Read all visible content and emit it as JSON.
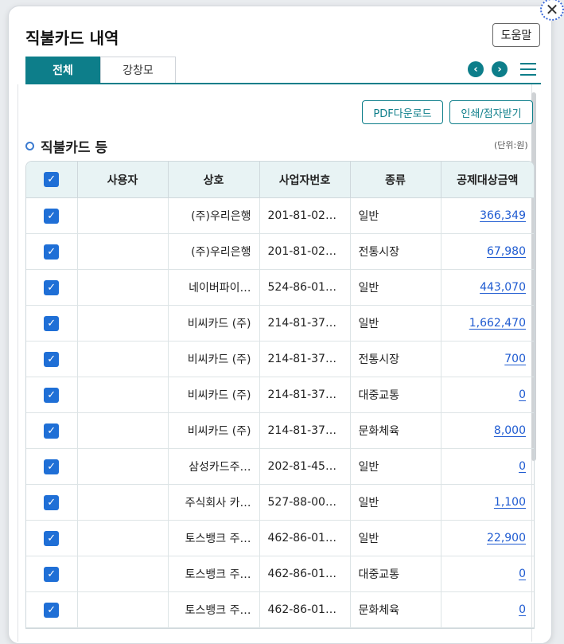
{
  "dialog": {
    "title": "직불카드 내역",
    "help_label": "도움말",
    "close_glyph": "✕"
  },
  "tabs": [
    {
      "label": "전체"
    },
    {
      "label": "강창모"
    }
  ],
  "nav": {
    "prev_glyph": "‹",
    "next_glyph": "›"
  },
  "actions": {
    "pdf_label": "PDF다운로드",
    "print_label": "인쇄/점자받기"
  },
  "section": {
    "title": "직불카드 등",
    "unit": "(단위:원)"
  },
  "table": {
    "columns": [
      "사용자",
      "상호",
      "사업자번호",
      "종류",
      "공제대상금액"
    ],
    "rows": [
      {
        "user": "",
        "name": "(주)우리은행",
        "bizno": "201-81-02…",
        "type": "일반",
        "amount": "366,349"
      },
      {
        "user": "",
        "name": "(주)우리은행",
        "bizno": "201-81-02…",
        "type": "전통시장",
        "amount": "67,980"
      },
      {
        "user": "",
        "name": "네이버파이…",
        "bizno": "524-86-01…",
        "type": "일반",
        "amount": "443,070"
      },
      {
        "user": "",
        "name": "비씨카드 (주)",
        "bizno": "214-81-37…",
        "type": "일반",
        "amount": "1,662,470"
      },
      {
        "user": "",
        "name": "비씨카드 (주)",
        "bizno": "214-81-37…",
        "type": "전통시장",
        "amount": "700"
      },
      {
        "user": "",
        "name": "비씨카드 (주)",
        "bizno": "214-81-37…",
        "type": "대중교통",
        "amount": "0"
      },
      {
        "user": "",
        "name": "비씨카드 (주)",
        "bizno": "214-81-37…",
        "type": "문화체육",
        "amount": "8,000"
      },
      {
        "user": "",
        "name": "삼성카드주…",
        "bizno": "202-81-45…",
        "type": "일반",
        "amount": "0"
      },
      {
        "user": "",
        "name": "주식회사 카…",
        "bizno": "527-88-00…",
        "type": "일반",
        "amount": "1,100"
      },
      {
        "user": "",
        "name": "토스뱅크 주…",
        "bizno": "462-86-01…",
        "type": "일반",
        "amount": "22,900"
      },
      {
        "user": "",
        "name": "토스뱅크 주…",
        "bizno": "462-86-01…",
        "type": "대중교통",
        "amount": "0"
      },
      {
        "user": "",
        "name": "토스뱅크 주…",
        "bizno": "462-86-01…",
        "type": "문화체육",
        "amount": "0"
      }
    ]
  },
  "colors": {
    "accent": "#0d7e8a",
    "checkbox": "#1f6fd6",
    "link": "#1f5bd1"
  }
}
